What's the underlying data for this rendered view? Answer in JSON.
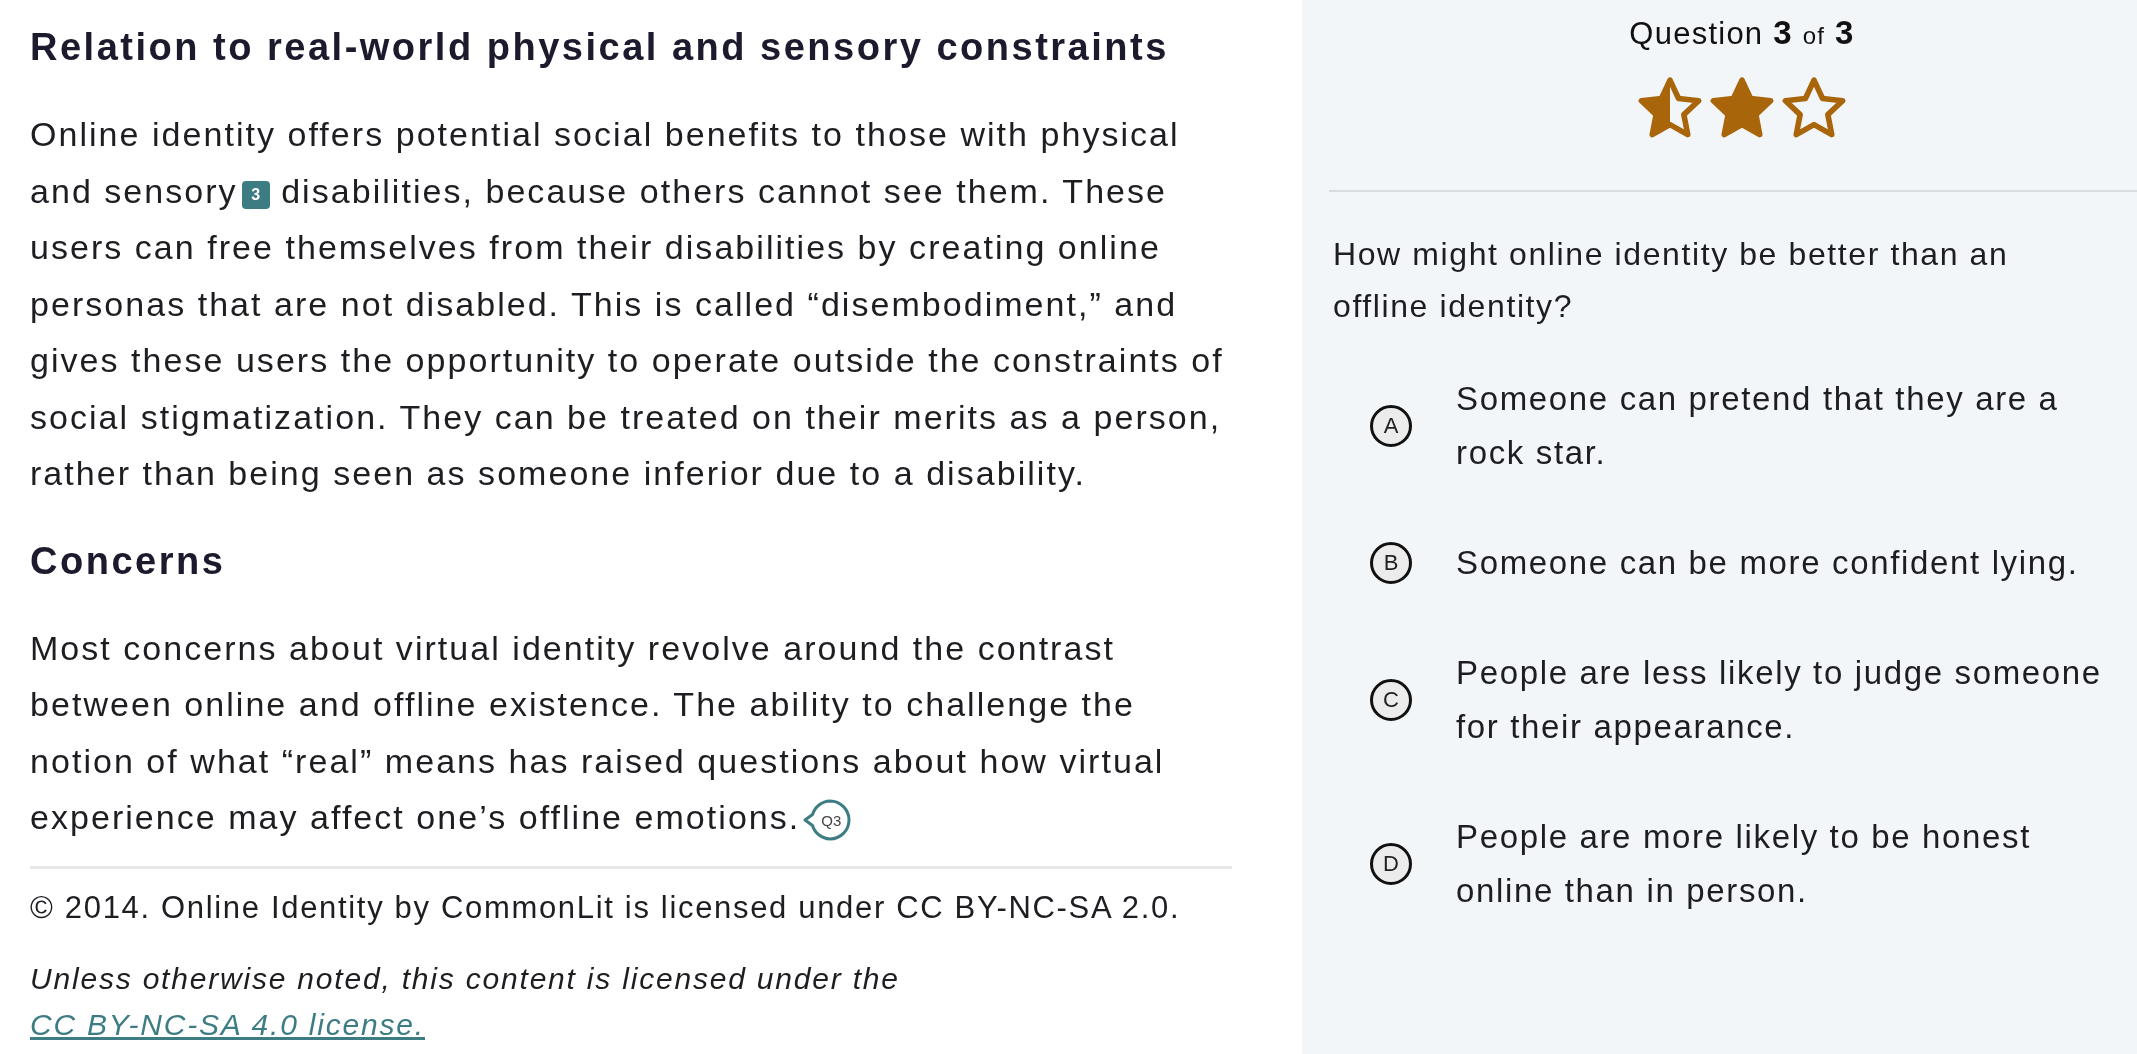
{
  "article": {
    "sections": [
      {
        "heading": "Relation to real-world physical and sensory constraints",
        "paragraphs": [
          {
            "parts": [
              {
                "kind": "text",
                "text": "Online identity offers potential social benefits to those with physical and sensory"
              },
              {
                "kind": "footnote",
                "label": "3"
              },
              {
                "kind": "text",
                "text": " disabilities, because others cannot see them. These users can free themselves from their disabilities by creating online personas that are not disabled. This is called “disembodiment,” and gives these users the opportunity to operate outside the constraints of social stigmatization. They can be treated on their merits as a person, rather than being seen as someone inferior due to a disability."
              }
            ]
          }
        ]
      },
      {
        "heading": "Concerns",
        "paragraphs": [
          {
            "parts": [
              {
                "kind": "text",
                "text": "Most concerns about virtual identity revolve around the contrast between online and offline existence. The ability to challenge the notion of what “real” means has raised questions about how virtual experience may affect one’s offline emotions."
              },
              {
                "kind": "question_marker",
                "label": "Q3"
              }
            ]
          }
        ]
      }
    ],
    "attribution": "© 2014. Online Identity by CommonLit is licensed under CC BY-NC-SA 2.0.",
    "license": {
      "text": "Unless otherwise noted, this content is licensed under the",
      "link": "CC BY-NC-SA 4.0 license."
    }
  },
  "quiz": {
    "counter": {
      "label": "Question",
      "current": "3",
      "connector": "of",
      "total": "3"
    },
    "rating_stars": [
      {
        "kind": "half"
      },
      {
        "kind": "full"
      },
      {
        "kind": "empty"
      }
    ],
    "question": "How might online identity be better than an offline identity?",
    "answers": [
      {
        "letter": "A",
        "text": "Someone can pretend that they are a rock star.",
        "selected": false
      },
      {
        "letter": "B",
        "text": "Someone can be more confident lying.",
        "selected": false
      },
      {
        "letter": "C",
        "text": "People are less likely to judge someone for their appearance.",
        "selected": false
      },
      {
        "letter": "D",
        "text": "People are more likely to be honest online than in person.",
        "selected": false
      }
    ]
  }
}
